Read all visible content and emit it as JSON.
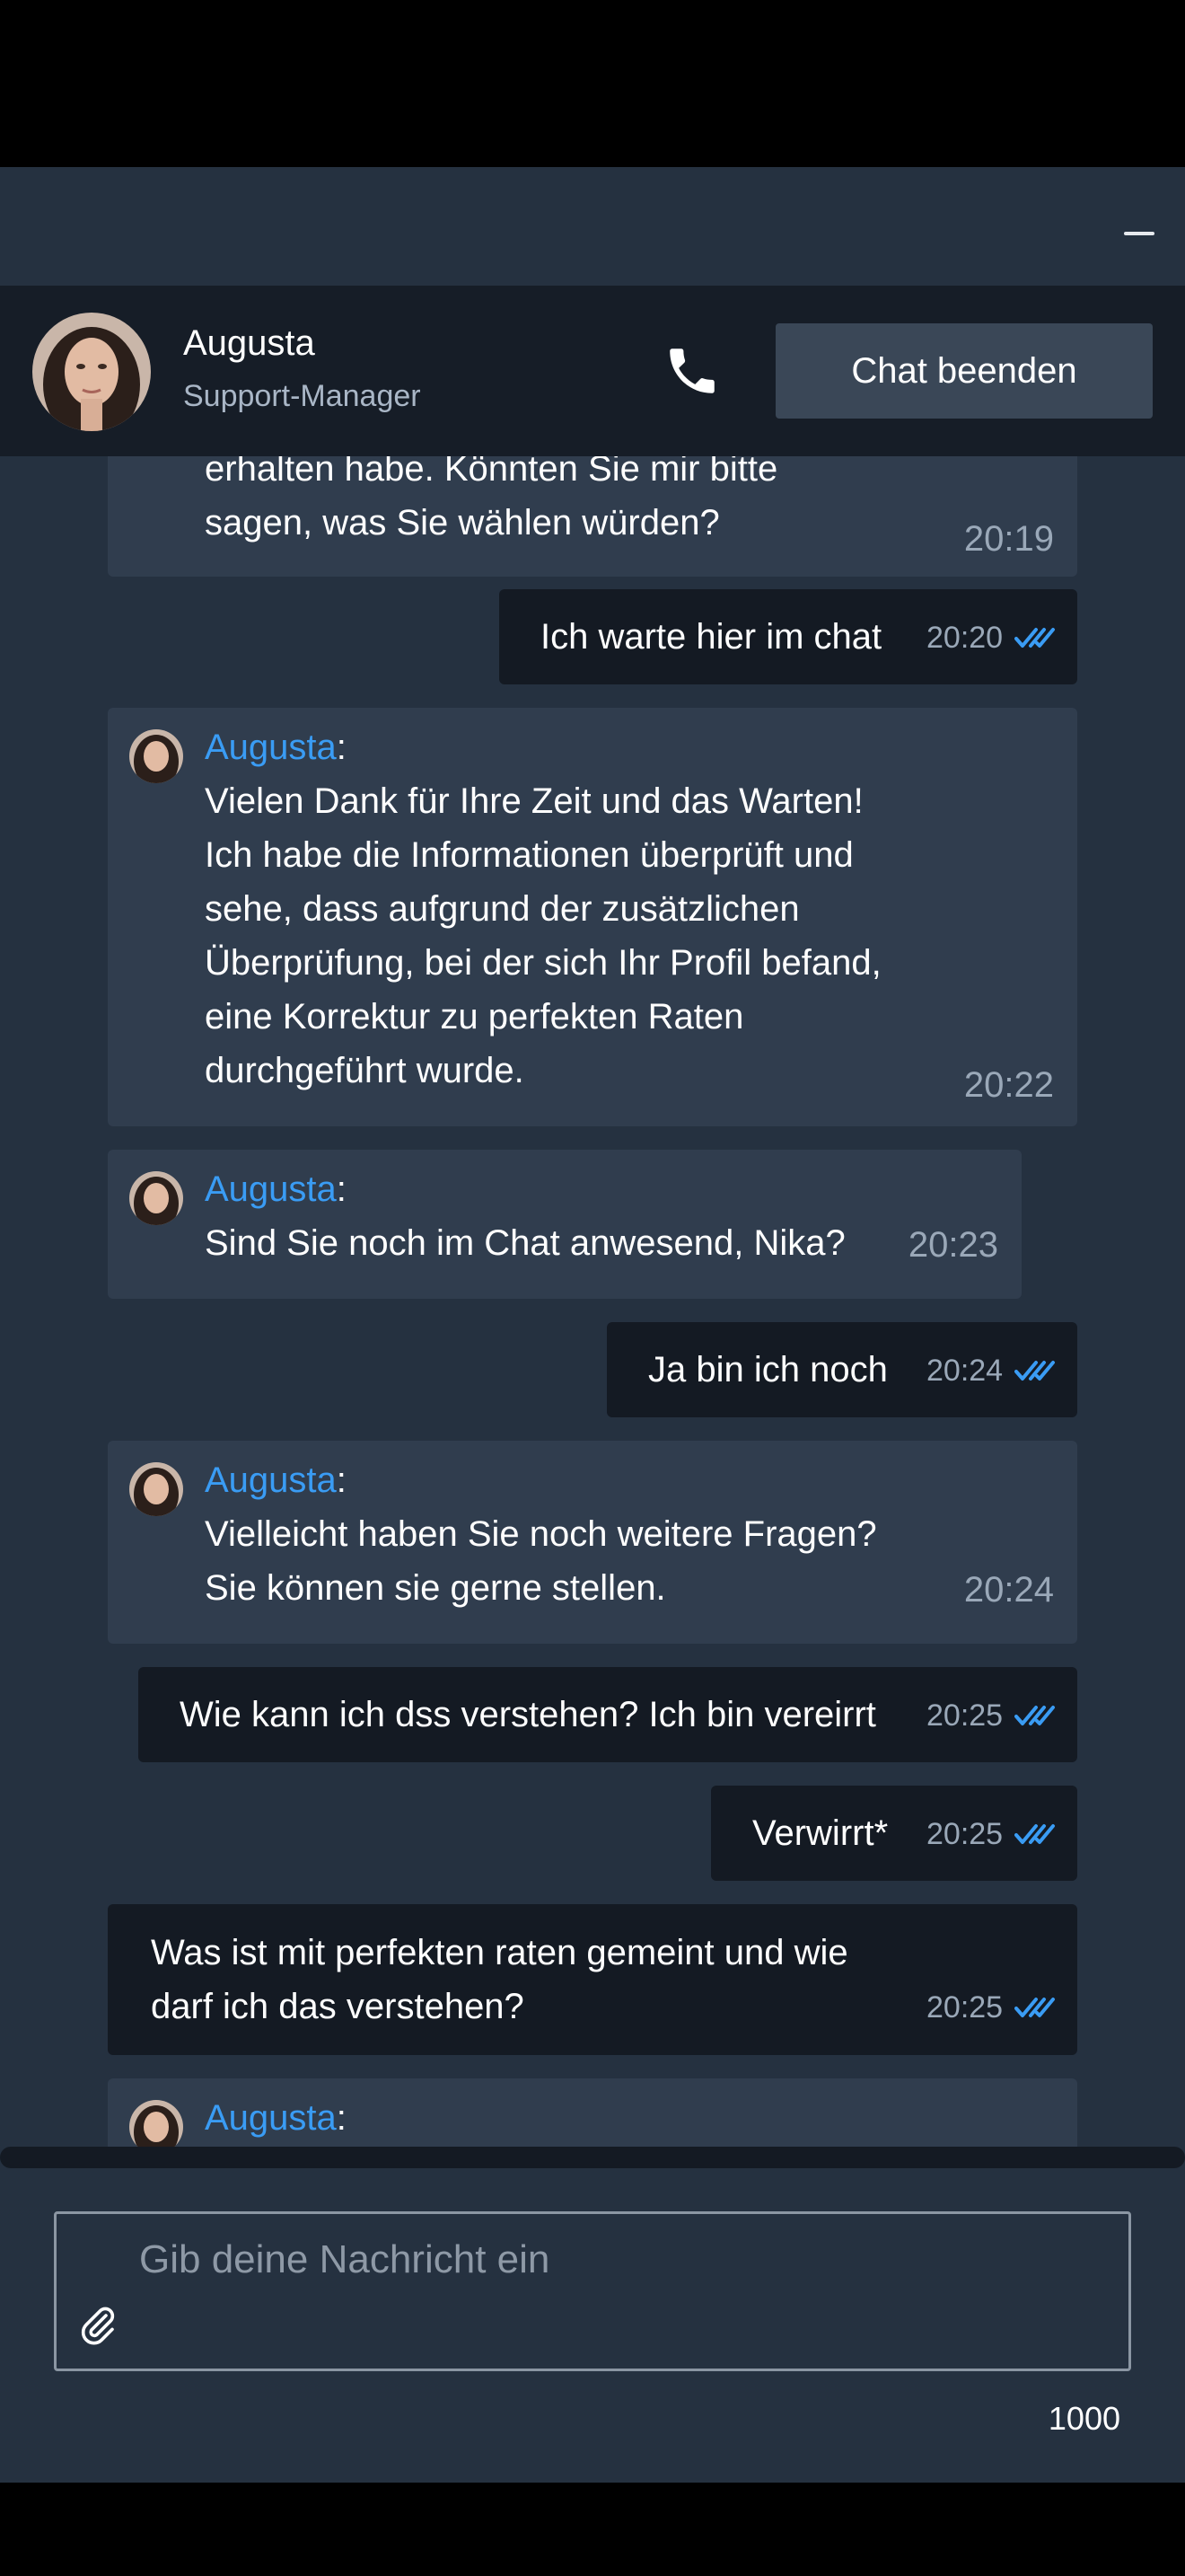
{
  "window": {
    "minimize_icon": "minimize-icon"
  },
  "header": {
    "agent_name": "Augusta",
    "agent_role": "Support-Manager",
    "call_icon": "phone-icon",
    "end_chat_label": "Chat beenden"
  },
  "messages": [
    {
      "type": "incoming",
      "text": "erhalten habe. Könnten Sie mir bitte\nsagen, was Sie wählen würden?",
      "time": "20:19"
    },
    {
      "type": "outgoing",
      "text": "Ich warte hier im chat",
      "time": "20:20",
      "status": "read"
    },
    {
      "type": "incoming",
      "sender": "Augusta",
      "text": "Vielen Dank für Ihre Zeit und das Warten!\nIch habe die Informationen überprüft und\nsehe, dass aufgrund der zusätzlichen\nÜberprüfung, bei der sich Ihr Profil befand,\neine Korrektur zu perfekten Raten\ndurchgeführt wurde.",
      "time": "20:22"
    },
    {
      "type": "incoming",
      "sender": "Augusta",
      "text": "Sind Sie noch im Chat anwesend, Nika?",
      "time": "20:23"
    },
    {
      "type": "outgoing",
      "text": "Ja bin ich noch",
      "time": "20:24",
      "status": "read"
    },
    {
      "type": "incoming",
      "sender": "Augusta",
      "text": "Vielleicht haben Sie noch weitere Fragen?\nSie können sie gerne stellen.",
      "time": "20:24"
    },
    {
      "type": "outgoing",
      "text": "Wie kann ich dss verstehen? Ich bin vereirrt",
      "time": "20:25",
      "status": "read"
    },
    {
      "type": "outgoing",
      "text": "Verwirrt*",
      "time": "20:25",
      "status": "read"
    },
    {
      "type": "outgoing",
      "text": "Was ist mit perfekten raten gemeint und wie\ndarf ich das verstehen?",
      "time": "20:25",
      "status": "read"
    },
    {
      "type": "incoming",
      "sender": "Augusta",
      "text": ""
    }
  ],
  "composer": {
    "placeholder": "Gib deine Nachricht ein",
    "value": "",
    "attach_icon": "paperclip-icon",
    "char_counter": "1000"
  },
  "colors": {
    "background": "#253140",
    "header_bg": "#161d27",
    "incoming_bubble": "#303d4e",
    "outgoing_bubble": "#141a23",
    "accent": "#3a9cf4",
    "button_bg": "#3a4757"
  }
}
